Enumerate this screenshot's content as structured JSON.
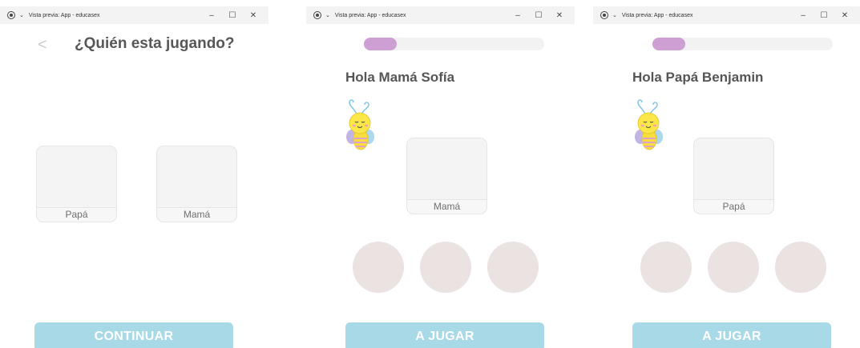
{
  "windows": [
    {
      "titlebar": {
        "title": "Vista previa: App - educasex",
        "chevron": "⌄",
        "minimize": "–",
        "maximize": "☐",
        "close": "✕"
      },
      "back_glyph": "<",
      "title": "¿Quién esta jugando?",
      "cards": [
        {
          "label": "Papá"
        },
        {
          "label": "Mamá"
        }
      ],
      "button": "CONTINUAR"
    },
    {
      "titlebar": {
        "title": "Vista previa: App - educasex",
        "chevron": "⌄",
        "minimize": "–",
        "maximize": "☐",
        "close": "✕"
      },
      "progress": 0.18,
      "greeting": "Hola Mamá Sofía",
      "mascot_icon": "bee-icon",
      "card": {
        "label": "Mamá"
      },
      "options_count": 3,
      "button": "A JUGAR"
    },
    {
      "titlebar": {
        "title": "Vista previa: App - educasex",
        "chevron": "⌄",
        "minimize": "–",
        "maximize": "☐",
        "close": "✕"
      },
      "progress": 0.18,
      "greeting": "Hola Papá Benjamin",
      "mascot_icon": "bee-icon",
      "card": {
        "label": "Papá"
      },
      "options_count": 3,
      "button": "A JUGAR"
    }
  ],
  "colors": {
    "accent_button": "#a8d9e6",
    "progress_fill": "#cd9fd2",
    "option_circle": "#ebe2e2"
  }
}
